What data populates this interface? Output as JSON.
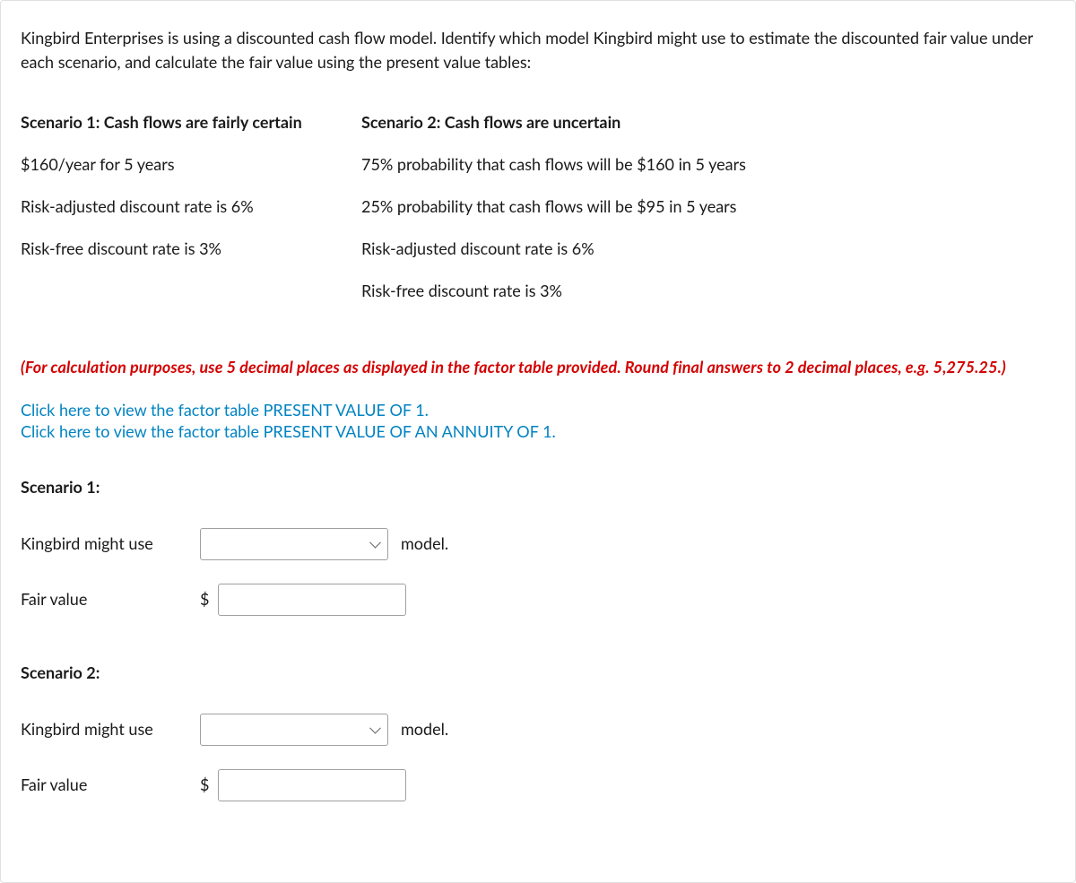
{
  "intro": "Kingbird Enterprises is using a discounted cash flow model. Identify which model Kingbird might use to estimate the discounted fair value under each scenario, and calculate the fair value using the present value tables:",
  "table": {
    "col1_header": "Scenario 1: Cash flows are fairly certain",
    "col2_header": "Scenario 2: Cash flows are uncertain",
    "col1": [
      "$160/year for 5 years",
      "Risk-adjusted discount rate is 6%",
      "Risk-free discount rate is 3%",
      ""
    ],
    "col2": [
      "75% probability that cash flows will be $160 in 5 years",
      "25% probability that cash flows will be $95 in 5 years",
      "Risk-adjusted discount rate is 6%",
      "Risk-free discount rate is 3%"
    ]
  },
  "instruction": "(For calculation purposes, use 5 decimal places as displayed in the factor table provided. Round final answers to 2 decimal places, e.g. 5,275.25.)",
  "links": {
    "pv1": "Click here to view the factor table PRESENT VALUE OF 1.",
    "pva1": "Click here to view the factor table PRESENT VALUE OF AN ANNUITY OF 1."
  },
  "s1": {
    "label": "Scenario 1:",
    "might_use": "Kingbird might use",
    "model_suffix": "model.",
    "fair_value_label": "Fair value",
    "currency": "$"
  },
  "s2": {
    "label": "Scenario 2:",
    "might_use": "Kingbird might use",
    "model_suffix": "model.",
    "fair_value_label": "Fair value",
    "currency": "$"
  }
}
